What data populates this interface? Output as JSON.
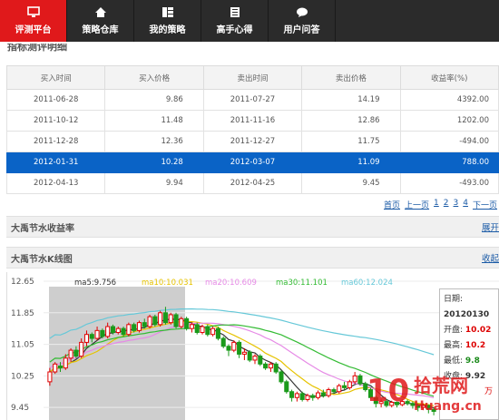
{
  "nav": {
    "items": [
      {
        "label": "评测平台",
        "icon": "monitor-icon"
      },
      {
        "label": "策略仓库",
        "icon": "home-icon"
      },
      {
        "label": "我的策略",
        "icon": "grid-icon"
      },
      {
        "label": "高手心得",
        "icon": "document-icon"
      },
      {
        "label": "用户问答",
        "icon": "chat-icon"
      }
    ]
  },
  "section_partial_title": "指标测评明细",
  "trades": {
    "headers": [
      "买入时间",
      "买入价格",
      "卖出时间",
      "卖出价格",
      "收益率(%)"
    ],
    "rows": [
      [
        "2011-06-28",
        "9.86",
        "2011-07-27",
        "14.19",
        "4392.00"
      ],
      [
        "2011-10-12",
        "11.48",
        "2011-11-16",
        "12.86",
        "1202.00"
      ],
      [
        "2011-12-28",
        "12.36",
        "2011-12-27",
        "11.75",
        "-494.00"
      ],
      [
        "2012-01-31",
        "10.28",
        "2012-03-07",
        "11.09",
        "788.00"
      ],
      [
        "2012-04-13",
        "9.94",
        "2012-04-25",
        "9.45",
        "-493.00"
      ]
    ],
    "selected_row": 3
  },
  "pager": {
    "first": "首页",
    "prev": "上一页",
    "pages": [
      "1",
      "2",
      "3",
      "4"
    ],
    "next": "下一页"
  },
  "returns_section": {
    "title": "大禹节水收益率",
    "link": "展开"
  },
  "kline_section": {
    "title": "大禹节水K线图",
    "link": "收起"
  },
  "chart_data": {
    "type": "candlestick",
    "y_ticks": [
      "12.65",
      "11.85",
      "11.05",
      "10.25",
      "9.45"
    ],
    "ylim": [
      9.2,
      12.65
    ],
    "ma_legend": [
      {
        "label": "ma5:9.756",
        "color": "#333333"
      },
      {
        "label": "ma10:10.031",
        "color": "#e6c300"
      },
      {
        "label": "ma20:10.609",
        "color": "#e68ae6"
      },
      {
        "label": "ma30:11.101",
        "color": "#33bb33"
      },
      {
        "label": "ma60:12.024",
        "color": "#66c8d8"
      }
    ],
    "candles": [
      [
        10.1,
        10.35,
        10.0,
        10.45
      ],
      [
        10.35,
        10.55,
        10.3,
        10.6
      ],
      [
        10.5,
        10.45,
        10.35,
        10.6
      ],
      [
        10.45,
        10.7,
        10.4,
        10.8
      ],
      [
        10.7,
        10.9,
        10.6,
        10.95
      ],
      [
        10.9,
        10.75,
        10.7,
        11.0
      ],
      [
        10.75,
        11.1,
        10.7,
        11.2
      ],
      [
        11.1,
        11.3,
        11.0,
        11.4
      ],
      [
        11.3,
        11.2,
        11.1,
        11.35
      ],
      [
        11.2,
        11.4,
        11.15,
        11.5
      ],
      [
        11.4,
        11.25,
        11.2,
        11.45
      ],
      [
        11.25,
        11.5,
        11.2,
        11.6
      ],
      [
        11.5,
        11.35,
        11.3,
        11.55
      ],
      [
        11.35,
        11.45,
        11.3,
        11.5
      ],
      [
        11.45,
        11.3,
        11.25,
        11.5
      ],
      [
        11.3,
        11.55,
        11.25,
        11.6
      ],
      [
        11.55,
        11.4,
        11.35,
        11.6
      ],
      [
        11.4,
        11.6,
        11.35,
        11.65
      ],
      [
        11.6,
        11.5,
        11.45,
        11.7
      ],
      [
        11.5,
        11.75,
        11.45,
        11.8
      ],
      [
        11.75,
        11.55,
        11.5,
        11.8
      ],
      [
        11.55,
        11.85,
        11.5,
        11.9
      ],
      [
        11.85,
        11.6,
        11.55,
        12.0
      ],
      [
        11.6,
        11.8,
        11.55,
        11.85
      ],
      [
        11.8,
        11.5,
        11.45,
        11.85
      ],
      [
        11.5,
        11.7,
        11.45,
        11.75
      ],
      [
        11.7,
        11.45,
        11.4,
        11.75
      ],
      [
        11.45,
        11.55,
        11.35,
        11.6
      ],
      [
        11.55,
        11.35,
        11.3,
        11.6
      ],
      [
        11.35,
        11.5,
        11.3,
        11.55
      ],
      [
        11.5,
        11.3,
        11.25,
        11.55
      ],
      [
        11.3,
        11.45,
        11.25,
        11.5
      ],
      [
        11.45,
        11.2,
        11.15,
        11.5
      ],
      [
        11.2,
        11.0,
        10.95,
        11.25
      ],
      [
        11.0,
        10.9,
        10.75,
        11.05
      ],
      [
        10.9,
        11.1,
        10.85,
        11.15
      ],
      [
        11.1,
        10.8,
        10.7,
        11.15
      ],
      [
        10.8,
        10.85,
        10.65,
        10.95
      ],
      [
        10.85,
        10.65,
        10.6,
        10.9
      ],
      [
        10.65,
        10.75,
        10.55,
        10.8
      ],
      [
        10.75,
        10.55,
        10.5,
        10.8
      ],
      [
        10.55,
        10.45,
        10.4,
        10.6
      ],
      [
        10.45,
        10.55,
        10.35,
        10.6
      ],
      [
        10.55,
        10.35,
        10.3,
        10.6
      ],
      [
        10.35,
        10.1,
        10.05,
        10.4
      ],
      [
        10.1,
        9.85,
        9.8,
        10.15
      ],
      [
        9.85,
        9.7,
        9.6,
        9.9
      ],
      [
        9.7,
        9.8,
        9.6,
        9.85
      ],
      [
        9.8,
        9.65,
        9.6,
        9.85
      ],
      [
        9.65,
        9.75,
        9.6,
        9.8
      ],
      [
        9.75,
        9.7,
        9.62,
        9.8
      ],
      [
        9.7,
        9.82,
        9.65,
        9.88
      ],
      [
        9.82,
        9.75,
        9.7,
        9.9
      ],
      [
        9.75,
        9.9,
        9.7,
        9.95
      ],
      [
        9.9,
        9.85,
        9.8,
        9.95
      ],
      [
        9.85,
        10.0,
        9.8,
        10.05
      ],
      [
        10.0,
        9.95,
        9.9,
        10.1
      ],
      [
        9.95,
        10.1,
        9.9,
        10.15
      ],
      [
        10.1,
        10.25,
        10.05,
        10.35
      ],
      [
        10.25,
        10.05,
        10.0,
        10.3
      ],
      [
        10.05,
        9.9,
        9.85,
        10.1
      ],
      [
        9.9,
        9.7,
        9.65,
        9.95
      ],
      [
        9.7,
        9.55,
        9.45,
        9.75
      ],
      [
        9.55,
        9.6,
        9.45,
        9.65
      ],
      [
        9.6,
        9.5,
        9.45,
        9.65
      ],
      [
        9.5,
        9.58,
        9.45,
        9.62
      ],
      [
        9.58,
        9.52,
        9.45,
        9.6
      ],
      [
        9.52,
        9.6,
        9.48,
        9.65
      ],
      [
        9.6,
        9.55,
        9.5,
        9.65
      ],
      [
        9.55,
        9.5,
        9.42,
        9.6
      ],
      [
        9.5,
        9.45,
        9.35,
        9.55
      ],
      [
        9.45,
        9.5,
        9.38,
        9.55
      ],
      [
        9.5,
        9.4,
        9.3,
        9.52
      ],
      [
        9.4,
        9.35,
        9.25,
        9.45
      ]
    ]
  },
  "info_box": {
    "date_label": "日期:",
    "date_value": "20120130",
    "open_label": "开盘:",
    "open_value": "10.02",
    "high_label": "最高:",
    "high_value": "10.2",
    "low_label": "最低:",
    "low_value": "9.8",
    "close_label": "收盘:",
    "close_value": "9.92",
    "extra_label": "万"
  },
  "watermark": {
    "number": "10",
    "name": "拾荒网",
    "url": "Huang.cn",
    "color": "#e0191b"
  }
}
